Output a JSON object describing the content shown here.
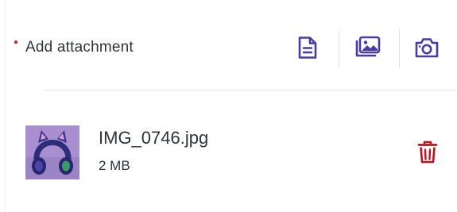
{
  "header": {
    "label": "Add attachment",
    "required": true,
    "actions": [
      {
        "name": "file",
        "icon": "file-text-icon"
      },
      {
        "name": "gallery",
        "icon": "image-gallery-icon"
      },
      {
        "name": "camera",
        "icon": "camera-icon"
      }
    ]
  },
  "attachments": [
    {
      "file_name": "IMG_0746.jpg",
      "file_size": "2 MB",
      "thumbnail": "purple-cat-ear-headphones",
      "delete_icon": "trash-icon"
    }
  ],
  "colors": {
    "accent": "#4a3aa8",
    "danger": "#c1121f",
    "required": "#cc1f1a",
    "text": "#2f3437",
    "divider": "#e6e6e6"
  }
}
